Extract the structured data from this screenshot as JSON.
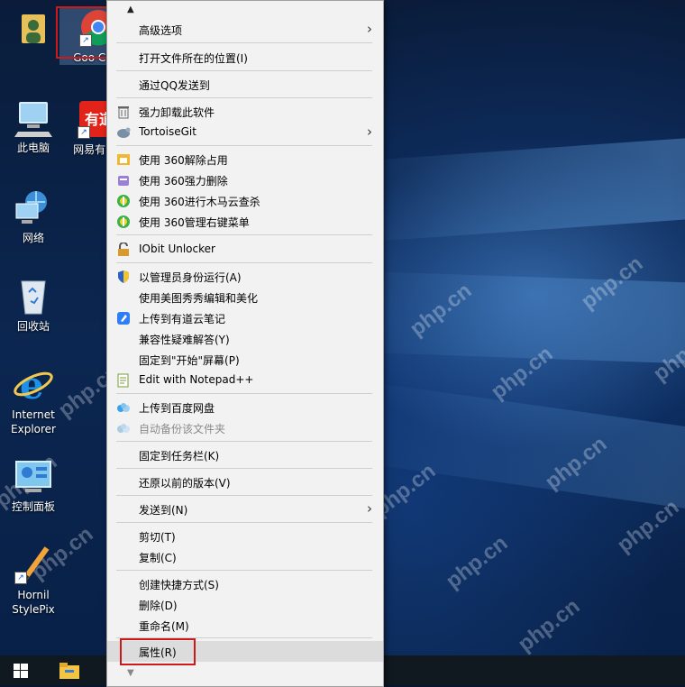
{
  "desktop": {
    "icons": [
      {
        "label": "",
        "icon": "user-folder-icon"
      },
      {
        "label": "此电脑",
        "icon": "computer-icon"
      },
      {
        "label": "网络",
        "icon": "network-icon"
      },
      {
        "label": "回收站",
        "icon": "recycle-bin-icon"
      },
      {
        "label": "Internet Explorer",
        "icon": "internet-explorer-icon"
      },
      {
        "label": "控制面板",
        "icon": "control-panel-icon"
      },
      {
        "label": "Hornil StylePix",
        "icon": "stylepix-icon"
      },
      {
        "label": "Goo Chro",
        "icon": "chrome-icon"
      },
      {
        "label": "网易有 典",
        "icon": "youdao-dict-icon"
      }
    ],
    "watermark": "php.cn"
  },
  "context_menu": {
    "scroll_up": "▲",
    "scroll_down": "▼",
    "items": [
      {
        "label": "高级选项",
        "submenu": true
      },
      {
        "label": "打开文件所在的位置(I)"
      },
      {
        "label": "通过QQ发送到"
      },
      {
        "label": "强力卸载此软件",
        "icon": "trash-icon"
      },
      {
        "label": "TortoiseGit",
        "icon": "tortoisegit-icon",
        "submenu": true
      },
      {
        "label": "使用 360解除占用",
        "icon": "360-unlock-icon"
      },
      {
        "label": "使用 360强力删除",
        "icon": "360-delete-icon"
      },
      {
        "label": "使用 360进行木马云查杀",
        "icon": "360-scan-icon"
      },
      {
        "label": "使用 360管理右键菜单",
        "icon": "360-menu-icon"
      },
      {
        "label": "IObit Unlocker",
        "icon": "iobit-unlocker-icon"
      },
      {
        "label": "以管理员身份运行(A)",
        "icon": "uac-shield-icon"
      },
      {
        "label": "使用美图秀秀编辑和美化"
      },
      {
        "label": "上传到有道云笔记",
        "icon": "youdao-note-icon"
      },
      {
        "label": "兼容性疑难解答(Y)"
      },
      {
        "label": "固定到\"开始\"屏幕(P)"
      },
      {
        "label": "Edit with Notepad++",
        "icon": "notepadpp-icon"
      },
      {
        "label": "上传到百度网盘",
        "icon": "baidu-netdisk-icon"
      },
      {
        "label": "自动备份该文件夹",
        "icon": "baidu-backup-icon",
        "disabled": true
      },
      {
        "label": "固定到任务栏(K)"
      },
      {
        "label": "还原以前的版本(V)"
      },
      {
        "label": "发送到(N)",
        "submenu": true
      },
      {
        "label": "剪切(T)"
      },
      {
        "label": "复制(C)"
      },
      {
        "label": "创建快捷方式(S)"
      },
      {
        "label": "删除(D)"
      },
      {
        "label": "重命名(M)"
      },
      {
        "label": "属性(R)",
        "highlighted": true
      }
    ]
  },
  "taskbar": {
    "start_icon": "windows-logo-icon",
    "pinned": [
      "file-explorer-icon"
    ]
  },
  "colors": {
    "highlight_box": "#d01818",
    "menu_bg": "#f2f2f2"
  }
}
